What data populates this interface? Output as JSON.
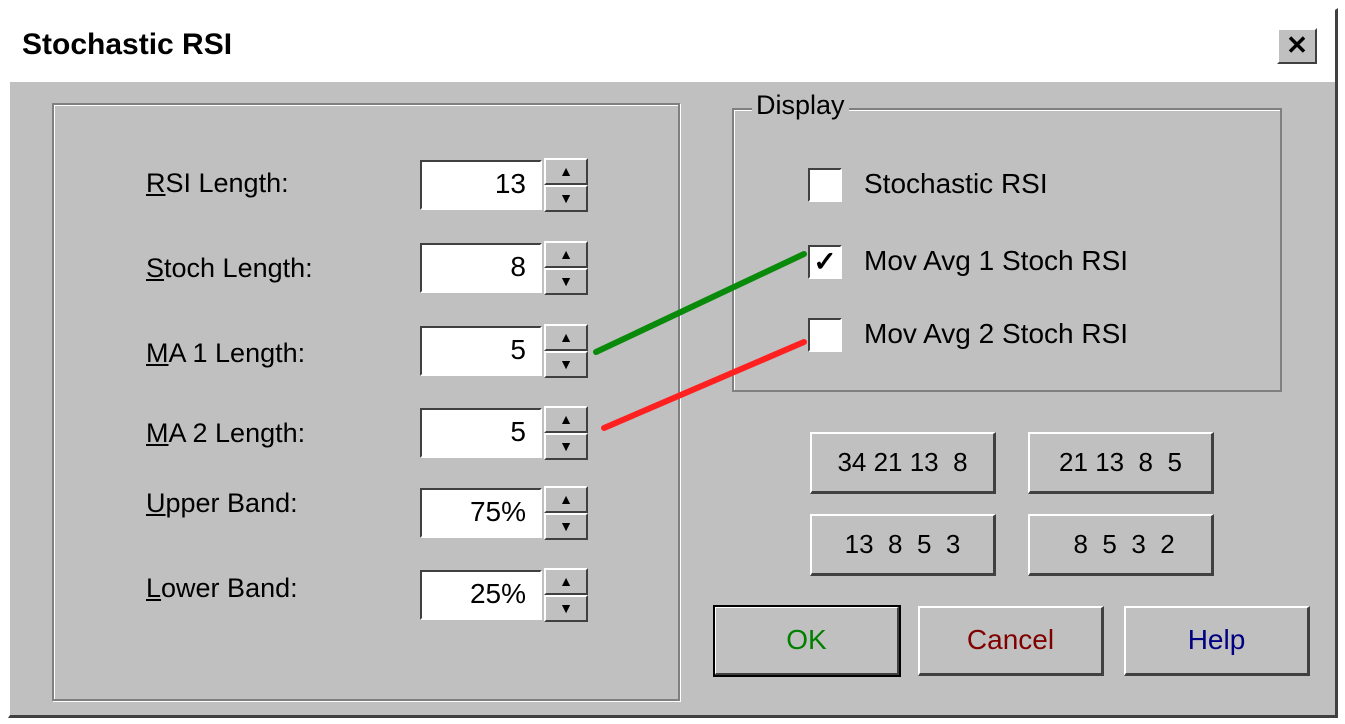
{
  "dialog": {
    "title": "Stochastic RSI",
    "close_label": "✕"
  },
  "params": [
    {
      "underline": "R",
      "rest": "SI Length:",
      "value": "13"
    },
    {
      "underline": "S",
      "rest": "toch Length:",
      "value": "8"
    },
    {
      "underline": "M",
      "rest": "A 1 Length:",
      "value": "5"
    },
    {
      "underline": "M",
      "rest": "A 2 Length:",
      "value": "5"
    },
    {
      "underline": "U",
      "rest": "pper Band:",
      "value": "75%"
    },
    {
      "underline": "L",
      "rest": "ower Band:",
      "value": "25%"
    }
  ],
  "display": {
    "legend": "Display",
    "options": [
      {
        "label": "Stochastic RSI",
        "checked": false,
        "mark": ""
      },
      {
        "label": "Mov Avg 1 Stoch RSI",
        "checked": true,
        "mark": "✓"
      },
      {
        "label": "Mov Avg 2 Stoch RSI",
        "checked": false,
        "mark": ""
      }
    ]
  },
  "presets": [
    "34 21 13  8",
    "21 13  8  5",
    "13  8  5  3",
    " 8  5  3  2"
  ],
  "buttons": {
    "ok": "OK",
    "cancel": "Cancel",
    "help": "Help"
  },
  "colors": {
    "ok": "#008000",
    "cancel": "#800000",
    "help": "#000080",
    "line_ma1": "#0a8a0a",
    "line_ma2": "#ff2020"
  }
}
